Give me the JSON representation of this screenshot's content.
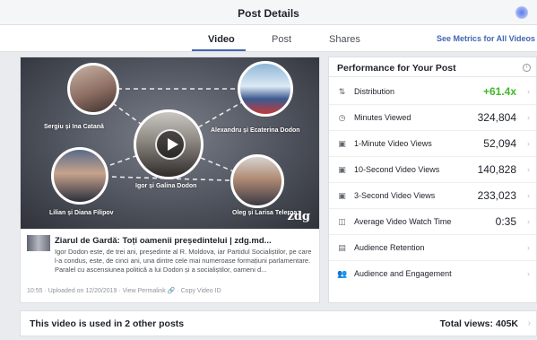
{
  "header": {
    "title": "Post Details",
    "accent": "#4267b2"
  },
  "tabs": [
    {
      "label": "Video",
      "active": true
    },
    {
      "label": "Post",
      "active": false
    },
    {
      "label": "Shares",
      "active": false
    }
  ],
  "metrics_link": "See Metrics for All Videos",
  "video": {
    "people": [
      "Sergiu și Ina Catană",
      "Alexandru și Ecaterina Dodon",
      "Igor și Galina Dodon",
      "Lilian și Diana Filipov",
      "Oleg și Larisa Teleroa"
    ],
    "brand": "zdg"
  },
  "post": {
    "title": "Ziarul de Gardă: Toți oamenii președintelui | zdg.md...",
    "description": "Igor Dodon este, de trei ani, președinte al R. Moldova, iar Partidul Socialiștilor, pe care l-a condus, este, de cinci ani, una dintre cele mai numeroase formațiuni parlamentare. Paralel cu ascensiunea politică a lui Dodon și a socialiștilor, oameni d...",
    "meta": "10:55 · Uploaded on 12/20/2019 · View Permalink 🔗 · Copy Video ID"
  },
  "performance": {
    "title": "Performance for Your Post",
    "info_icon": "info-icon",
    "rows": [
      {
        "icon": "distribution-icon",
        "label": "Distribution",
        "value": "+61.4x",
        "positive_color": "#42b72a"
      },
      {
        "icon": "clock-icon",
        "label": "Minutes Viewed",
        "value": "324,804"
      },
      {
        "icon": "video-views-icon",
        "label": "1-Minute Video Views",
        "value": "52,094"
      },
      {
        "icon": "video-views-icon",
        "label": "10-Second Video Views",
        "value": "140,828"
      },
      {
        "icon": "video-views-icon",
        "label": "3-Second Video Views",
        "value": "233,023"
      },
      {
        "icon": "video-camera-icon",
        "label": "Average Video Watch Time",
        "value": "0:35"
      },
      {
        "icon": "film-icon",
        "label": "Audience Retention",
        "value": ""
      },
      {
        "icon": "people-icon",
        "label": "Audience and Engagement",
        "value": ""
      }
    ]
  },
  "shares_summary": {
    "left": "This video is used in 2 other posts",
    "right": "Total views: 405K"
  }
}
